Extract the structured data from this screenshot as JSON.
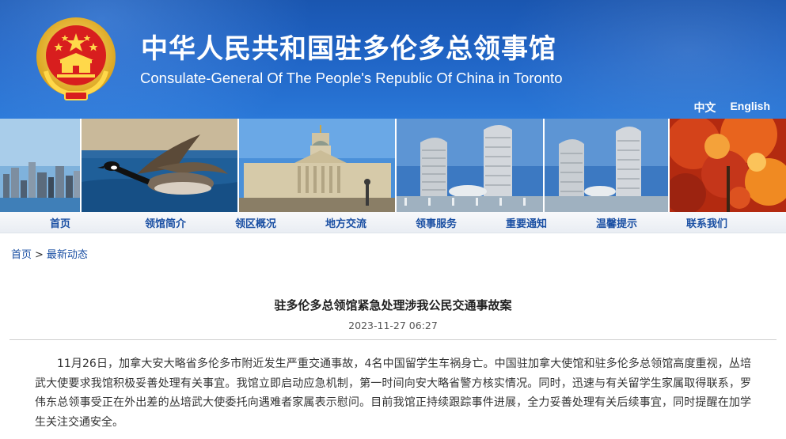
{
  "header": {
    "title_cn": "中华人民共和国驻多伦多总领事馆",
    "title_en": "Consulate-General Of The People's Republic Of China in Toronto",
    "languages": [
      "中文",
      "English"
    ],
    "colors": {
      "banner": "#1f63c4",
      "link": "#1a4fa3"
    }
  },
  "photos": [
    "city-skyline",
    "canada-goose",
    "legislative-building",
    "toronto-city-hall",
    "toronto-city-hall",
    "autumn-maple-leaves"
  ],
  "nav": {
    "items": [
      "首页",
      "领馆简介",
      "领区概况",
      "地方交流",
      "领事服务",
      "重要通知",
      "温馨提示",
      "联系我们"
    ]
  },
  "breadcrumb": {
    "home": "首页",
    "separator": ">",
    "current": "最新动态"
  },
  "article": {
    "title": "驻多伦多总领馆紧急处理涉我公民交通事故案",
    "date": "2023-11-27 06:27",
    "body": "11月26日，加拿大安大略省多伦多市附近发生严重交通事故，4名中国留学生车祸身亡。中国驻加拿大使馆和驻多伦多总领馆高度重视，丛培武大使要求我馆积极妥善处理有关事宜。我馆立即启动应急机制，第一时间向安大略省警方核实情况。同时，迅速与有关留学生家属取得联系，罗伟东总领事受正在外出差的丛培武大使委托向遇难者家属表示慰问。目前我馆正持续跟踪事件进展，全力妥善处理有关后续事宜，同时提醒在加学生关注交通安全。"
  }
}
